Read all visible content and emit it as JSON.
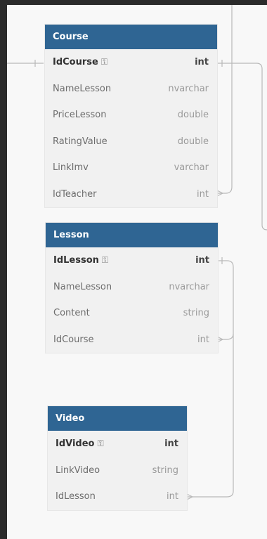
{
  "entities": {
    "course": {
      "title": "Course",
      "fields": [
        {
          "name": "IdCourse",
          "type": "int",
          "pk": true
        },
        {
          "name": "NameLesson",
          "type": "nvarchar"
        },
        {
          "name": "PriceLesson",
          "type": "double"
        },
        {
          "name": "RatingValue",
          "type": "double"
        },
        {
          "name": "LinkImv",
          "type": "varchar"
        },
        {
          "name": "IdTeacher",
          "type": "int"
        }
      ]
    },
    "lesson": {
      "title": "Lesson",
      "fields": [
        {
          "name": "IdLesson",
          "type": "int",
          "pk": true
        },
        {
          "name": "NameLesson",
          "type": "nvarchar"
        },
        {
          "name": "Content",
          "type": "string"
        },
        {
          "name": "IdCourse",
          "type": "int"
        }
      ]
    },
    "video": {
      "title": "Video",
      "fields": [
        {
          "name": "IdVideo",
          "type": "int",
          "pk": true
        },
        {
          "name": "LinkVideo",
          "type": "string"
        },
        {
          "name": "IdLesson",
          "type": "int"
        }
      ]
    }
  },
  "icons": {
    "primary_key": "key-icon"
  },
  "colors": {
    "header": "#2f6593",
    "body": "#f1f1f1",
    "connector": "#b9b9b9"
  }
}
